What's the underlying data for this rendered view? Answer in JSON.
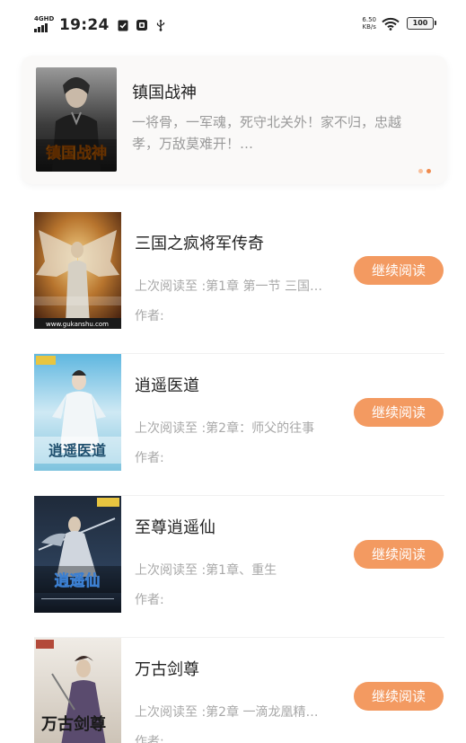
{
  "status_bar": {
    "network": "4GHD",
    "time": "19:24",
    "speed_value": "6.50",
    "speed_unit": "KB/s",
    "battery": "100"
  },
  "featured": {
    "title": "镇国战神",
    "description": "一将骨，一军魂，死守北关外！家不归，忠越孝，万敌莫难开！…",
    "cover_text": "镇国战神"
  },
  "books": [
    {
      "title": "三国之疯将军传奇",
      "progress": "上次阅读至 :第1章 第一节 三国…",
      "author": "作者:",
      "button": "继续阅读",
      "cover_site": "www.gukanshu.com"
    },
    {
      "title": "逍遥医道",
      "progress": "上次阅读至 :第2章：师父的往事",
      "author": "作者:",
      "button": "继续阅读",
      "cover_text": "逍遥医道"
    },
    {
      "title": "至尊逍遥仙",
      "progress": "上次阅读至 :第1章、重生",
      "author": "作者:",
      "button": "继续阅读",
      "cover_text": "逍遥仙"
    },
    {
      "title": "万古剑尊",
      "progress": "上次阅读至 :第2章 一滴龙凰精…",
      "author": "作者:",
      "button": "继续阅读",
      "cover_text": "万古剑尊"
    }
  ],
  "colors": {
    "accent": "#f39a61",
    "muted_text": "#a8a8a8",
    "title_text": "#222222",
    "banner_bg": "#faf9f8"
  }
}
